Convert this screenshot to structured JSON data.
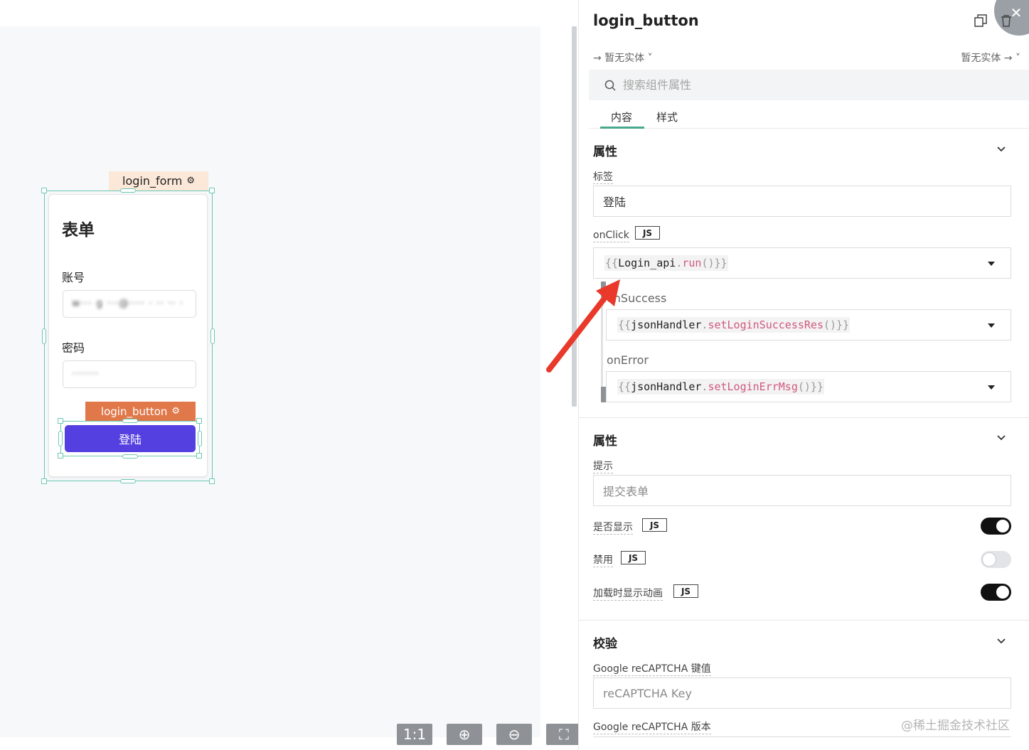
{
  "canvas": {
    "form": {
      "tag_label": "login_form",
      "title": "表单",
      "account_label": "账号",
      "account_value": "w··· g ···@···· · ·· ·· ·",
      "password_label": "密码",
      "password_value": "·······"
    },
    "button": {
      "tag_label": "login_button",
      "label": "登陆"
    },
    "zoom": {
      "reset": "1:1",
      "zoom_in": "⊕",
      "zoom_out": "⊖",
      "fit": "⛶"
    }
  },
  "panel": {
    "title": "login_button",
    "entity_left": "→ 暂无实体 ˅",
    "entity_right": "暂无实体 → ˅",
    "search_placeholder": "搜索组件属性",
    "tabs": [
      "内容",
      "样式"
    ],
    "section1": {
      "title": "属性",
      "label_field": "标签",
      "label_value": "登陆",
      "onclick_label": "onClick",
      "js": "JS",
      "onclick": {
        "brace_open": "{{",
        "obj": "Login_api",
        "dot": ".",
        "method": "run",
        "rest": "()}}"
      },
      "success_label": "onSuccess",
      "success": {
        "brace_open": "{{",
        "obj": "jsonHandler",
        "dot": ".",
        "method": "setLoginSuccessRes",
        "rest": "()}}"
      },
      "error_label": "onError",
      "error": {
        "brace_open": "{{",
        "obj": "jsonHandler",
        "dot": ".",
        "method": "setLoginErrMsg",
        "rest": "()}}"
      }
    },
    "section2": {
      "title": "属性",
      "tooltip_label": "提示",
      "tooltip_placeholder": "提交表单",
      "visible_label": "是否显示",
      "disabled_label": "禁用",
      "loading_label": "加载时显示动画",
      "js": "JS",
      "visible": true,
      "disabled": false,
      "loading": true
    },
    "section3": {
      "title": "校验",
      "recaptcha_key_label": "Google reCAPTCHA 键值",
      "recaptcha_key_placeholder": "reCAPTCHA Key",
      "recaptcha_version_label": "Google reCAPTCHA 版本"
    },
    "watermark": "@稀土掘金技术社区"
  },
  "colors": {
    "primary_button": "#5440e0",
    "button_tag": "#e0784a",
    "form_tag": "#fbe8d9",
    "selection": "#6ac7b1",
    "tab_active": "#4aa88e",
    "arrow": "#e8392a"
  }
}
